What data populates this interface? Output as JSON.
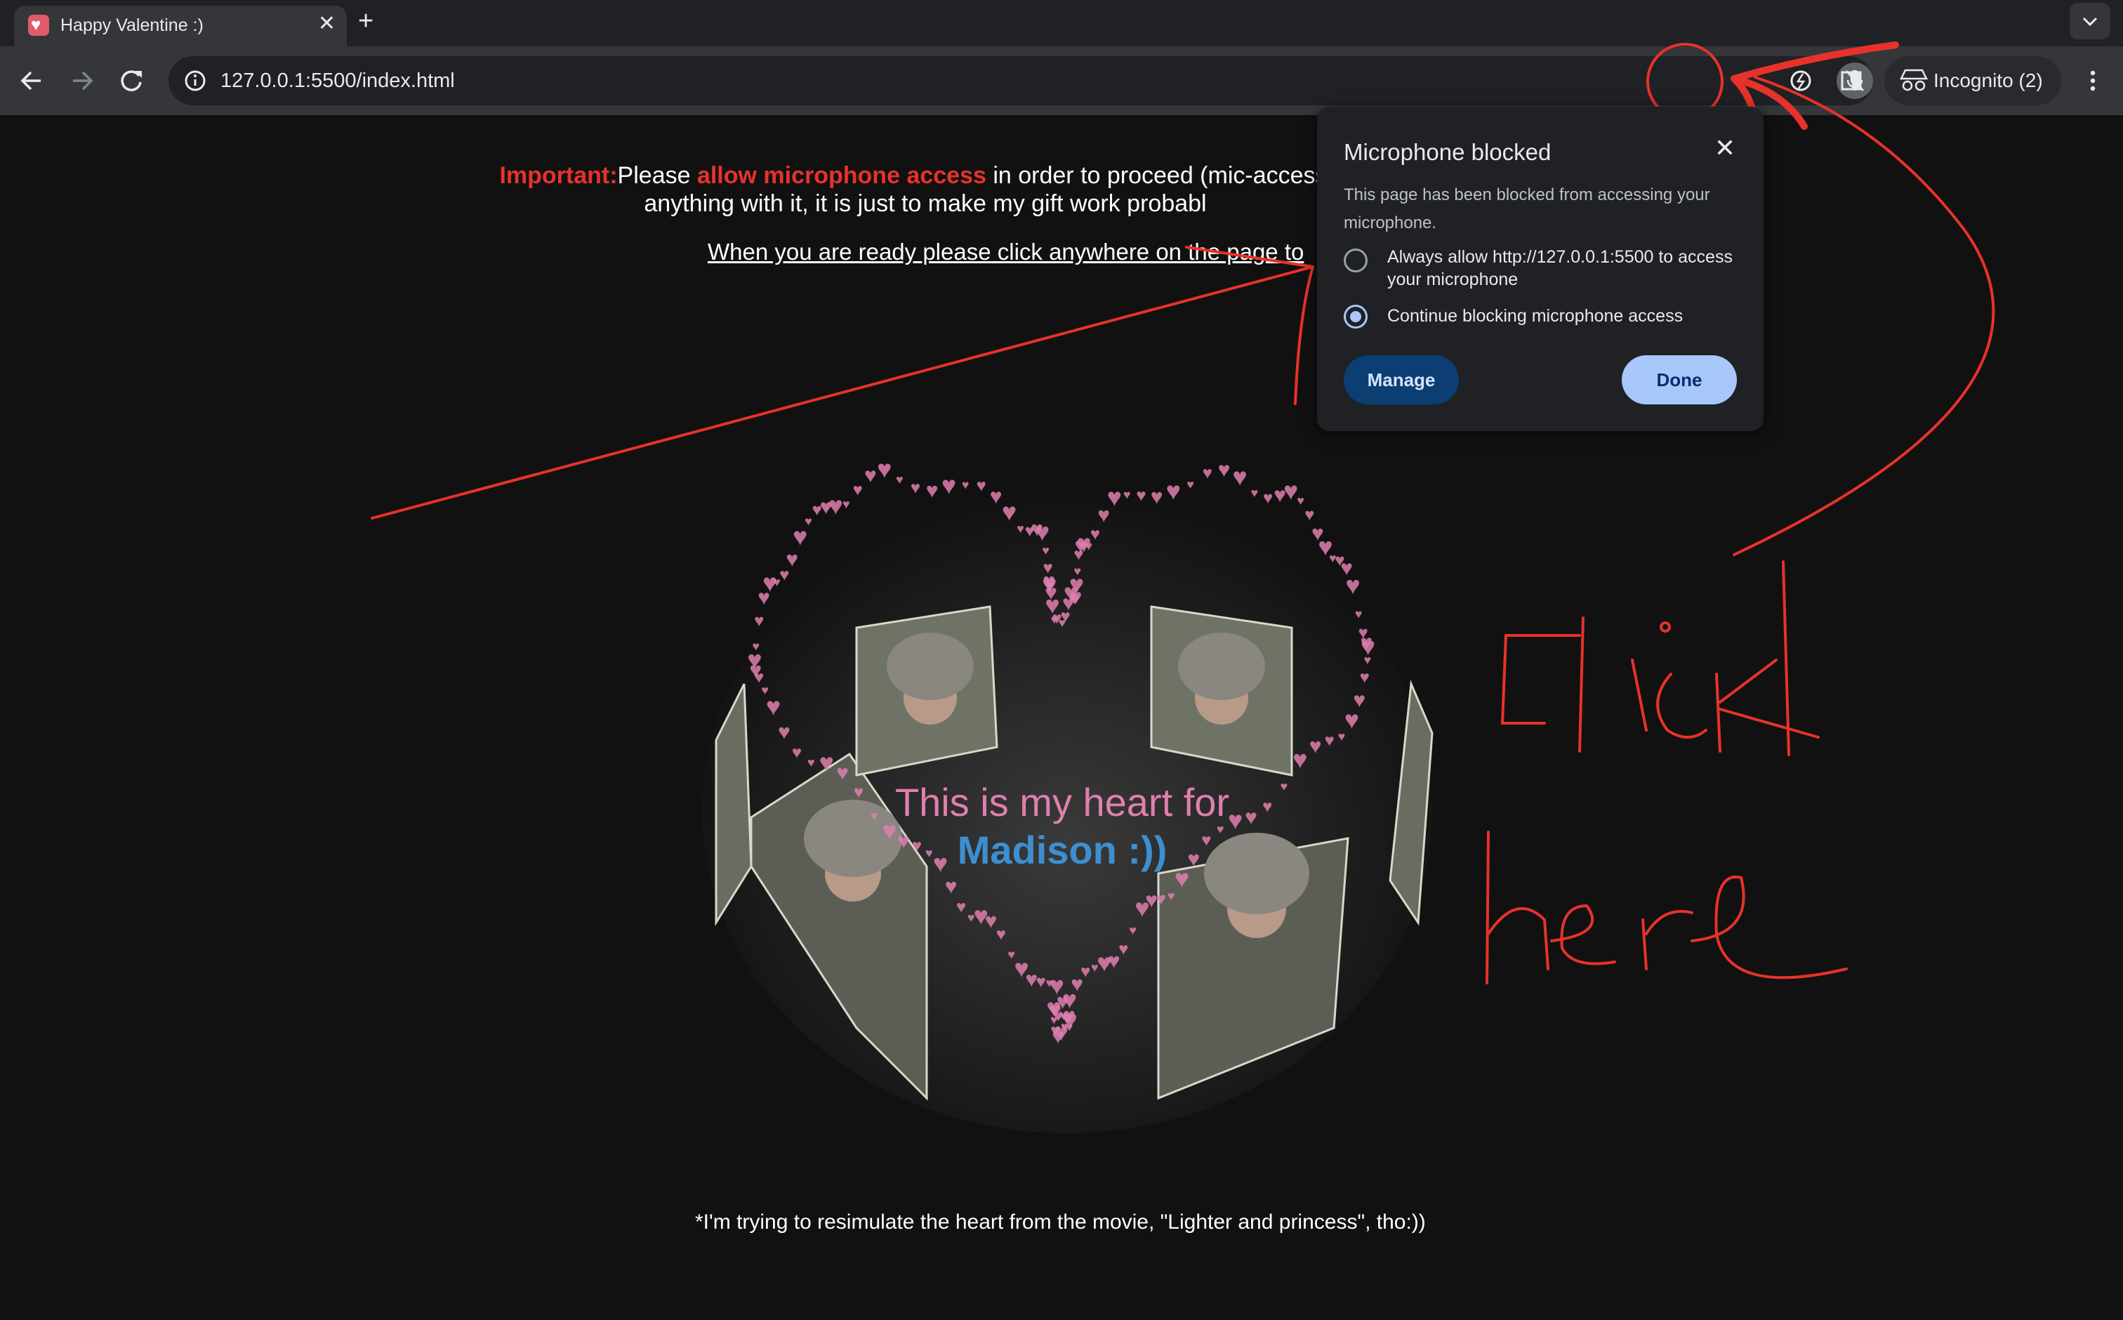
{
  "browser": {
    "tab": {
      "title": "Happy Valentine :)",
      "favicon": "heart-favicon"
    },
    "url": "127.0.0.1:5500/index.html",
    "profile_label": "Incognito (2)",
    "icons": [
      "back-icon",
      "forward-icon",
      "reload-icon",
      "site-info-icon",
      "mic-blocked-icon",
      "star-icon",
      "extensions-icon",
      "side-panel-icon",
      "incognito-icon",
      "menu-icon",
      "tab-search-icon"
    ]
  },
  "page": {
    "notice": {
      "important": "Important:",
      "pre": "Please ",
      "allow": "allow microphone access",
      "post": " in order to proceed (mic-access is",
      "line2": "anything with it, it is just to make my gift work probabl"
    },
    "ready": "When you are ready please click anywhere on the page to",
    "heart_text": {
      "line1": "This is my heart for",
      "line2": "Madison :))"
    },
    "footer": "*I'm trying to resimulate the heart from the movie, \"Lighter and princess\", tho:))"
  },
  "popup": {
    "title": "Microphone blocked",
    "description": "This page has been blocked from accessing your microphone.",
    "options": [
      {
        "label": "Always allow http://127.0.0.1:5500 to access your microphone",
        "checked": false
      },
      {
        "label": "Continue blocking microphone access",
        "checked": true
      }
    ],
    "manage": "Manage",
    "done": "Done"
  },
  "annotation": {
    "line1": "click",
    "line2": "here",
    "color": "#e7322b"
  },
  "colors": {
    "accent_red": "#e7322b",
    "heart_pink": "#e07fb0",
    "name_blue": "#3d8fd0"
  }
}
